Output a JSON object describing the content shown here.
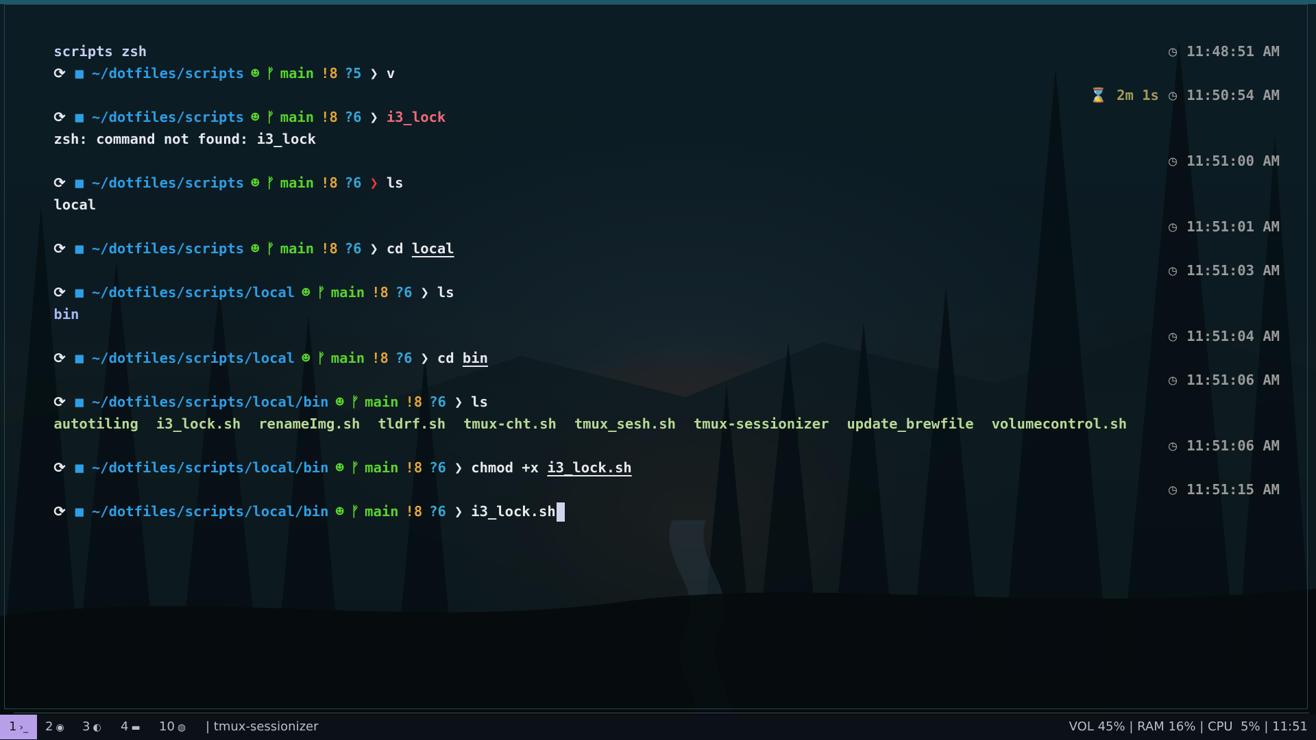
{
  "title": "scripts zsh",
  "prompts": [
    {
      "path": "~/dotfiles/scripts",
      "branch": "main",
      "mod": "!8",
      "untracked": "?5",
      "cmd": "v",
      "time": "11:48:51 AM"
    },
    {
      "path": "~/dotfiles/scripts",
      "branch": "main",
      "mod": "!8",
      "untracked": "?6",
      "cmd": "i3_lock",
      "time": "11:50:54 AM",
      "duration": "2m 1s"
    },
    {
      "path": "~/dotfiles/scripts",
      "branch": "main",
      "mod": "!8",
      "untracked": "?6",
      "cmd": "ls",
      "time": "11:51:00 AM"
    },
    {
      "path": "~/dotfiles/scripts",
      "branch": "main",
      "mod": "!8",
      "untracked": "?6",
      "cmd": "cd",
      "arg": "local",
      "time": "11:51:01 AM"
    },
    {
      "path": "~/dotfiles/scripts/local",
      "branch": "main",
      "mod": "!8",
      "untracked": "?6",
      "cmd": "ls",
      "time": "11:51:03 AM"
    },
    {
      "path": "~/dotfiles/scripts/local",
      "branch": "main",
      "mod": "!8",
      "untracked": "?6",
      "cmd": "cd",
      "arg": "bin",
      "time": "11:51:04 AM"
    },
    {
      "path": "~/dotfiles/scripts/local/bin",
      "branch": "main",
      "mod": "!8",
      "untracked": "?6",
      "cmd": "ls",
      "time": "11:51:06 AM"
    },
    {
      "path": "~/dotfiles/scripts/local/bin",
      "branch": "main",
      "mod": "!8",
      "untracked": "?6",
      "cmd": "chmod +x",
      "arg": "i3_lock.sh",
      "time": "11:51:06 AM"
    },
    {
      "path": "~/dotfiles/scripts/local/bin",
      "branch": "main",
      "mod": "!8",
      "untracked": "?6",
      "cmd": "i3_lock.sh",
      "time": "11:51:15 AM"
    }
  ],
  "outputs": {
    "error": "zsh: command not found: i3_lock",
    "ls1": "local",
    "ls2": "bin",
    "ls3": [
      "autotiling",
      "i3_lock.sh",
      "renameImg.sh",
      "tldrf.sh",
      "tmux-cht.sh",
      "tmux_sesh.sh",
      "tmux-sessionizer",
      "update_brewfile",
      "volumecontrol.sh"
    ]
  },
  "statusbar": {
    "workspaces": [
      "1",
      "2",
      "3",
      "4",
      "10"
    ],
    "window_title": "tmux-sessionizer",
    "vol": "VOL 45%",
    "ram": "RAM 16%",
    "cpu": "CPU  5%",
    "clock": "11:51"
  },
  "icons": {
    "prompt": "⟳-icon",
    "folder": "folder-icon",
    "git": "github-cat-icon",
    "branch": "branch-icon",
    "clock": "clock-icon",
    "hourglass": "hourglass-icon"
  },
  "colors": {
    "path": "#2d9fe6",
    "branch": "#59d42d",
    "modified": "#e2a53a",
    "untracked": "#35a7d6",
    "error": "#ef3a3a",
    "active_ws": "#b7a0e8"
  }
}
